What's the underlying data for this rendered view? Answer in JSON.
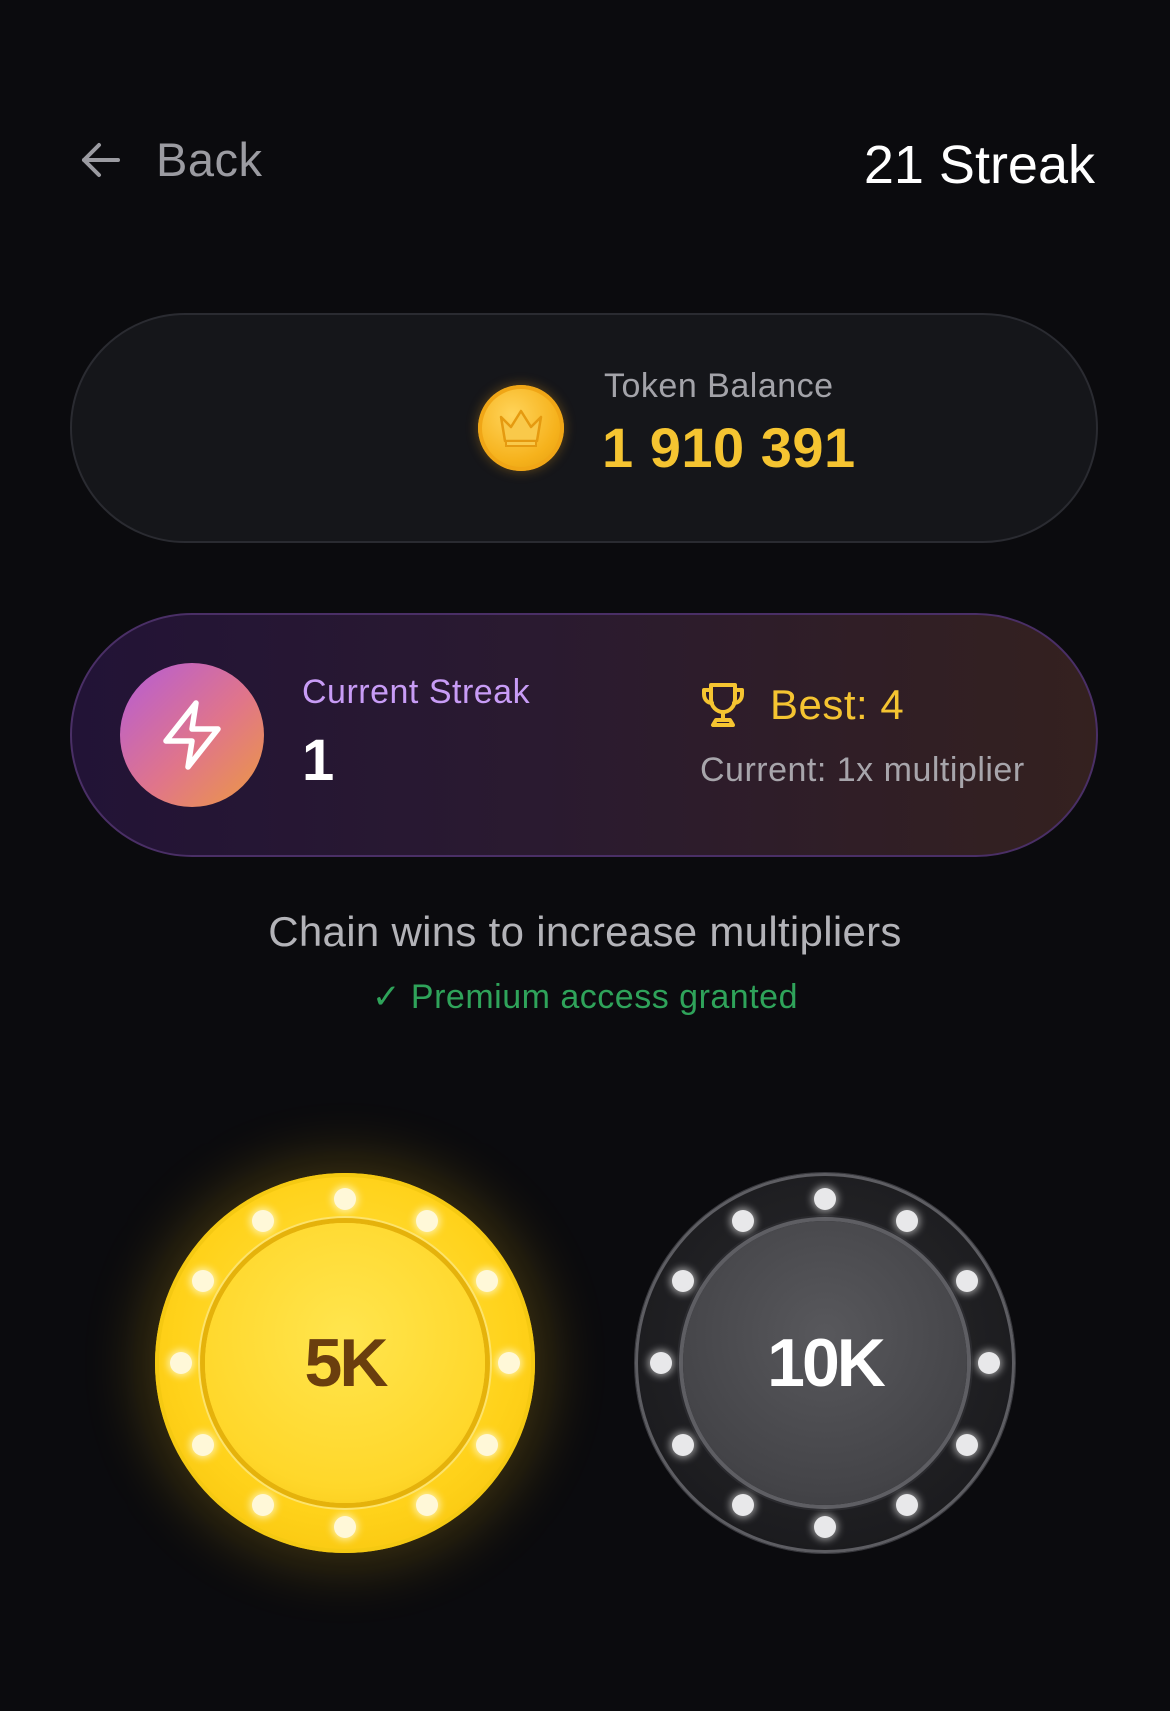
{
  "header": {
    "back_label": "Back",
    "title": "21 Streak"
  },
  "balance": {
    "label": "Token Balance",
    "value": "1 910 391",
    "coin_icon": "crown-coin-icon"
  },
  "streak": {
    "current_label": "Current Streak",
    "current_value": "1",
    "best_label": "Best: 4",
    "multiplier_text": "Current: 1x multiplier",
    "badge_icon": "lightning-bolt-icon",
    "best_icon": "trophy-icon"
  },
  "info": {
    "chain_text": "Chain wins to increase multipliers",
    "premium_text": "✓ Premium access granted"
  },
  "chips": [
    {
      "label": "5K",
      "style": "gold",
      "accent": "#ffd21a"
    },
    {
      "label": "10K",
      "style": "dark",
      "accent": "#444448"
    }
  ],
  "colors": {
    "background": "#0b0b0e",
    "gold": "#f5c431",
    "purple_label": "#c89cf6",
    "success_green": "#2fa35a"
  }
}
